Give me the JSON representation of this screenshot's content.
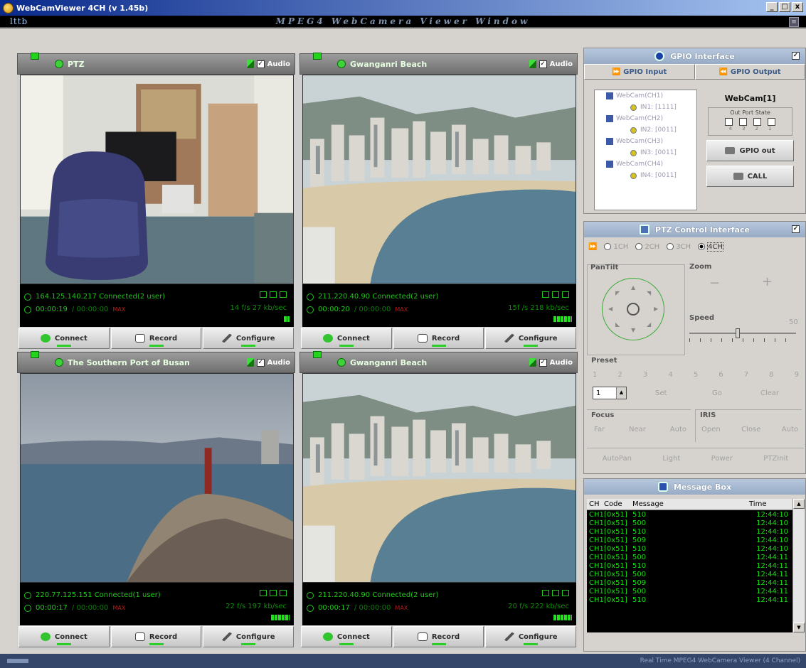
{
  "window": {
    "title": "WebCamViewer 4CH (v 1.45b)",
    "min": "_",
    "max": "□",
    "close": "x"
  },
  "banner": {
    "logo": "lttb",
    "title": "MPEG4 WebCamera Viewer Window"
  },
  "cams": [
    {
      "name": "PTZ",
      "audio": "Audio",
      "ip": "164.125.140.217  Connected(2 user)",
      "time": "00:00:19",
      "total": "/ 00:00:00",
      "maxlabel": "MAX",
      "rate": "14 f/s   27 kb/sec",
      "connect": "Connect",
      "record": "Record",
      "configure": "Configure"
    },
    {
      "name": "Gwanganri Beach",
      "audio": "Audio",
      "ip": "211.220.40.90    Connected(2 user)",
      "time": "00:00:20",
      "total": "/ 00:00:00",
      "maxlabel": "MAX",
      "rate": "15f /s  218 kb/sec",
      "connect": "Connect",
      "record": "Record",
      "configure": "Configure"
    },
    {
      "name": "The Southern Port of Busan",
      "audio": "Audio",
      "ip": "220.77.125.151   Connected(1 user)",
      "time": "00:00:17",
      "total": "/ 00:00:00",
      "maxlabel": "MAX",
      "rate": "22 f/s  197 kb/sec",
      "connect": "Connect",
      "record": "Record",
      "configure": "Configure"
    },
    {
      "name": "Gwanganri Beach",
      "audio": "Audio",
      "ip": "211.220.40.90    Connected(2 user)",
      "time": "00:00:17",
      "total": "/ 00:00:00",
      "maxlabel": "MAX",
      "rate": "20 f/s  222 kb/sec",
      "connect": "Connect",
      "record": "Record",
      "configure": "Configure"
    }
  ],
  "gpio": {
    "title": "GPIO Interface",
    "input_tab": "GPIO Input",
    "output_tab": "GPIO Output",
    "tree": [
      {
        "cam": "WebCam(CH1)",
        "in": "IN1: [1111]"
      },
      {
        "cam": "WebCam(CH2)",
        "in": "IN2: [0011]"
      },
      {
        "cam": "WebCam(CH3)",
        "in": "IN3: [0011]"
      },
      {
        "cam": "WebCam(CH4)",
        "in": "IN4: [0011]"
      }
    ],
    "webcam": "WebCam[1]",
    "out_port_state": "Out Port State",
    "port_nums": [
      "4",
      "3",
      "2",
      "1"
    ],
    "gpio_out": "GPIO out",
    "call": "CALL"
  },
  "ptz": {
    "title": "PTZ Control Interface",
    "channels": [
      "1CH",
      "2CH",
      "3CH",
      "4CH"
    ],
    "pantilt": "PanTilt",
    "zoom": "Zoom",
    "zoom_minus": "−",
    "zoom_plus": "+",
    "speed": "Speed",
    "speed_value": "50",
    "preset": "Preset",
    "preset_nums": [
      "1",
      "2",
      "3",
      "4",
      "5",
      "6",
      "7",
      "8",
      "9"
    ],
    "preset_select": "1",
    "set": "Set",
    "go": "Go",
    "clear": "Clear",
    "focus": "Focus",
    "focus_btns": [
      "Far",
      "Near",
      "Auto"
    ],
    "iris": "IRIS",
    "iris_btns": [
      "Open",
      "Close",
      "Auto"
    ],
    "bottom_btns": [
      "AutoPan",
      "Light",
      "Power",
      "PTZInit"
    ]
  },
  "msgbox": {
    "title": "Message Box",
    "headers": [
      "CH",
      "Code",
      "Message",
      "Time"
    ],
    "rows": [
      [
        "CH1",
        "[0x51]",
        "510",
        "12:44:10"
      ],
      [
        "CH1",
        "[0x51]",
        "500",
        "12:44:10"
      ],
      [
        "CH1",
        "[0x51]",
        "510",
        "12:44:10"
      ],
      [
        "CH1",
        "[0x51]",
        "509",
        "12:44:10"
      ],
      [
        "CH1",
        "[0x51]",
        "510",
        "12:44:10"
      ],
      [
        "CH1",
        "[0x51]",
        "500",
        "12:44:11"
      ],
      [
        "CH1",
        "[0x51]",
        "510",
        "12:44:11"
      ],
      [
        "CH1",
        "[0x51]",
        "500",
        "12:44:11"
      ],
      [
        "CH1",
        "[0x51]",
        "509",
        "12:44:11"
      ],
      [
        "CH1",
        "[0x51]",
        "500",
        "12:44:11"
      ],
      [
        "CH1",
        "[0x51]",
        "510",
        "12:44:11"
      ]
    ]
  },
  "statusbar": {
    "text": "Real Time MPEG4 WebCamera Viewer (4 Channel)"
  }
}
